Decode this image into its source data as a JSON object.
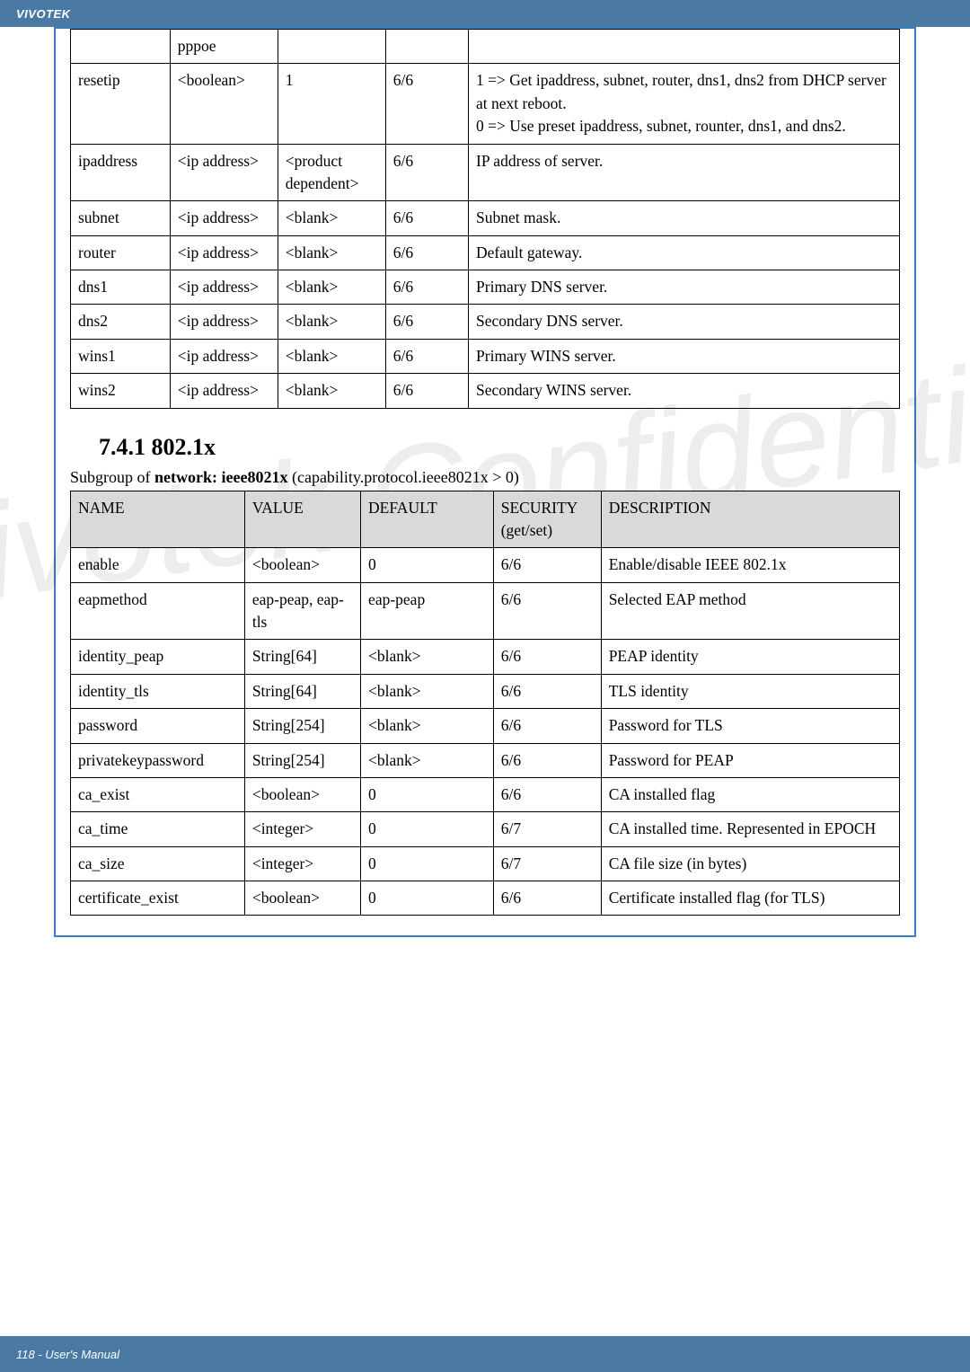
{
  "brand": "VIVOTEK",
  "footer": "118 - User's Manual",
  "watermark": "Vivotek Confidential",
  "table1": {
    "rows": [
      {
        "c0": "",
        "c1": "pppoe",
        "c2": "",
        "c3": "",
        "c4": ""
      },
      {
        "c0": "resetip",
        "c1": "<boolean>",
        "c2": "1",
        "c3": "6/6",
        "c4": "1 => Get ipaddress, subnet, router, dns1, dns2 from DHCP server at next reboot.\n0 => Use preset ipaddress, subnet, rounter, dns1, and dns2."
      },
      {
        "c0": "ipaddress",
        "c1": "<ip address>",
        "c2": "<product dependent>",
        "c3": "6/6",
        "c4": "IP address of server."
      },
      {
        "c0": "subnet",
        "c1": "<ip address>",
        "c2": "<blank>",
        "c3": "6/6",
        "c4": "Subnet mask."
      },
      {
        "c0": "router",
        "c1": "<ip address>",
        "c2": "<blank>",
        "c3": "6/6",
        "c4": "Default gateway."
      },
      {
        "c0": "dns1",
        "c1": "<ip address>",
        "c2": "<blank>",
        "c3": "6/6",
        "c4": "Primary DNS server."
      },
      {
        "c0": "dns2",
        "c1": "<ip address>",
        "c2": "<blank>",
        "c3": "6/6",
        "c4": "Secondary DNS server."
      },
      {
        "c0": "wins1",
        "c1": "<ip address>",
        "c2": "<blank>",
        "c3": "6/6",
        "c4": "Primary WINS server."
      },
      {
        "c0": "wins2",
        "c1": "<ip address>",
        "c2": "<blank>",
        "c3": "6/6",
        "c4": "Secondary WINS server."
      }
    ]
  },
  "section": {
    "heading": "7.4.1 802.1x",
    "subgroup_prefix": "Subgroup of ",
    "subgroup_bold": "network: ieee8021x",
    "subgroup_suffix": " (capability.protocol.ieee8021x > 0)"
  },
  "table2": {
    "headers": {
      "h0": "NAME",
      "h1": "VALUE",
      "h2": "DEFAULT",
      "h3": "SECURITY (get/set)",
      "h4": "DESCRIPTION"
    },
    "rows": [
      {
        "c0": "enable",
        "c1": "<boolean>",
        "c2": "0",
        "c3": "6/6",
        "c4": "Enable/disable IEEE 802.1x"
      },
      {
        "c0": "eapmethod",
        "c1": "eap-peap, eap-tls",
        "c2": "eap-peap",
        "c3": "6/6",
        "c4": "Selected EAP method"
      },
      {
        "c0": "identity_peap",
        "c1": "String[64]",
        "c2": "<blank>",
        "c3": "6/6",
        "c4": "PEAP identity"
      },
      {
        "c0": "identity_tls",
        "c1": "String[64]",
        "c2": "<blank>",
        "c3": "6/6",
        "c4": "TLS identity"
      },
      {
        "c0": "password",
        "c1": "String[254]",
        "c2": "<blank>",
        "c3": "6/6",
        "c4": "Password for TLS"
      },
      {
        "c0": "privatekeypassword",
        "c1": "String[254]",
        "c2": "<blank>",
        "c3": "6/6",
        "c4": "Password for PEAP"
      },
      {
        "c0": "ca_exist",
        "c1": "<boolean>",
        "c2": "0",
        "c3": "6/6",
        "c4": "CA installed flag"
      },
      {
        "c0": "ca_time",
        "c1": "<integer>",
        "c2": "0",
        "c3": "6/7",
        "c4": "CA installed time. Represented in EPOCH"
      },
      {
        "c0": "ca_size",
        "c1": "<integer>",
        "c2": "0",
        "c3": "6/7",
        "c4": "CA file size (in bytes)"
      },
      {
        "c0": "certificate_exist",
        "c1": "<boolean>",
        "c2": "0",
        "c3": "6/6",
        "c4": "Certificate installed flag (for TLS)"
      }
    ]
  },
  "colwidths1": [
    "12%",
    "13%",
    "13%",
    "10%",
    "52%"
  ],
  "colwidths2": [
    "21%",
    "14%",
    "16%",
    "13%",
    "36%"
  ]
}
